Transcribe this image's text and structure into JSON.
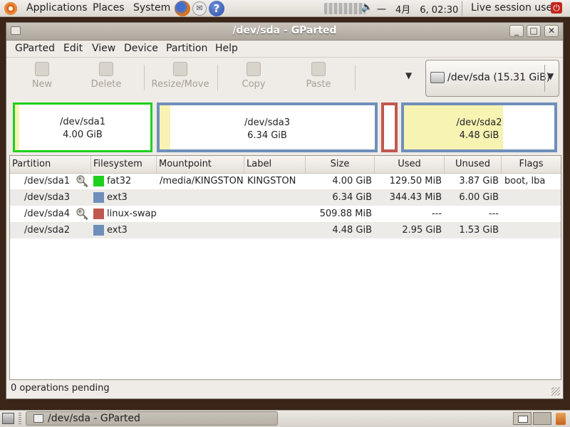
{
  "top_panel": {
    "menus": [
      "Applications",
      "Places",
      "System"
    ],
    "clock": "一　4月　6, 02:30",
    "session_user": "Live session user"
  },
  "window": {
    "title": "/dev/sda - GParted",
    "menu": [
      "GParted",
      "Edit",
      "View",
      "Device",
      "Partition",
      "Help"
    ],
    "toolbar": [
      "New",
      "Delete",
      "Resize/Move",
      "Copy",
      "Paste"
    ],
    "device_selector": "/dev/sda  (15.31 GiB)"
  },
  "graph": [
    {
      "name": "/dev/sda1",
      "size": "4.00 GiB",
      "used_fraction": 0.03,
      "color": "#1ed01e",
      "selected": true
    },
    {
      "name": "/dev/sda3",
      "size": "6.34 GiB",
      "used_fraction": 0.05,
      "color": "#6f8fbb",
      "selected": false
    },
    {
      "name": "",
      "size": "",
      "used_fraction": 0,
      "color": "#c0584f",
      "selected": false
    },
    {
      "name": "/dev/sda2",
      "size": "4.48 GiB",
      "used_fraction": 0.66,
      "color": "#6f8fbb",
      "selected": false
    }
  ],
  "table": {
    "headers": [
      "Partition",
      "Filesystem",
      "Mountpoint",
      "Label",
      "Size",
      "Used",
      "Unused",
      "Flags"
    ],
    "rows": [
      {
        "partition": "/dev/sda1",
        "key": true,
        "fs": "fat32",
        "fs_color": "#1ed01e",
        "mount": "/media/KINGSTON",
        "label": "KINGSTON",
        "size": "4.00 GiB",
        "used": "129.50 MiB",
        "unused": "3.87 GiB",
        "flags": "boot, lba"
      },
      {
        "partition": "/dev/sda3",
        "key": false,
        "fs": "ext3",
        "fs_color": "#6f8fbb",
        "mount": "",
        "label": "",
        "size": "6.34 GiB",
        "used": "344.43 MiB",
        "unused": "6.00 GiB",
        "flags": ""
      },
      {
        "partition": "/dev/sda4",
        "key": true,
        "fs": "linux-swap",
        "fs_color": "#c0584f",
        "mount": "",
        "label": "",
        "size": "509.88 MiB",
        "used": "---",
        "unused": "---",
        "flags": ""
      },
      {
        "partition": "/dev/sda2",
        "key": false,
        "fs": "ext3",
        "fs_color": "#6f8fbb",
        "mount": "",
        "label": "",
        "size": "4.48 GiB",
        "used": "2.95 GiB",
        "unused": "1.53 GiB",
        "flags": ""
      }
    ]
  },
  "status": "0 operations pending",
  "taskbar": {
    "window_label": "/dev/sda - GParted"
  }
}
